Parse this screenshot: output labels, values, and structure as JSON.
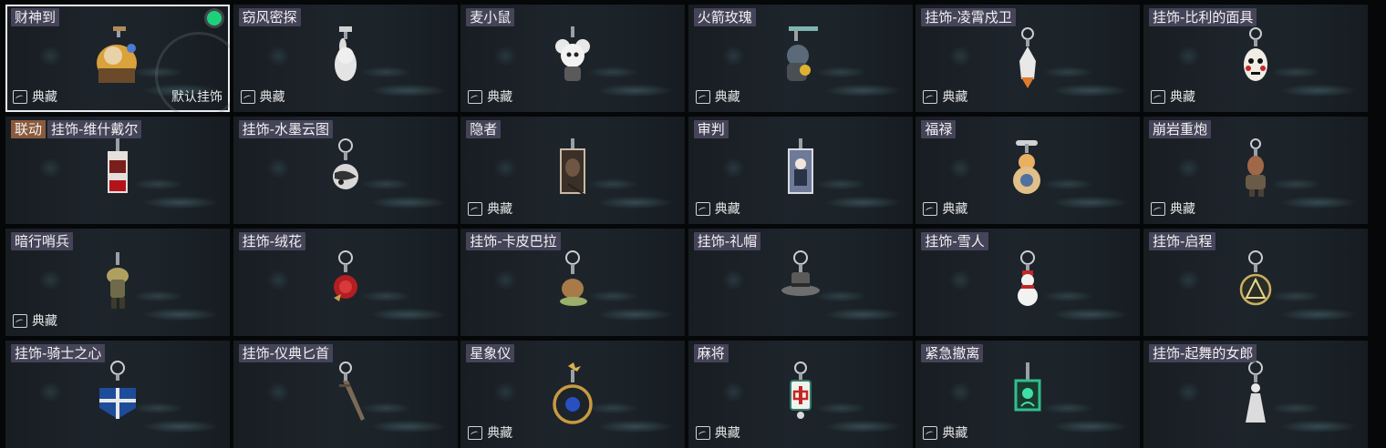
{
  "collect_label": "典藏",
  "default_label": "默认挂饰",
  "colors": {
    "selected_dot": "#1ed07c",
    "name_bg": "#4e4a62",
    "collab_tag_bg": "#8a5a3c"
  },
  "items": [
    {
      "name": "财神到",
      "collect": true,
      "selected": true,
      "icon": "god-of-wealth-charm-icon"
    },
    {
      "name": "窃风密探",
      "collect": true,
      "icon": "rabbit-spy-charm-icon"
    },
    {
      "name": "麦小鼠",
      "collect": true,
      "icon": "mouse-charm-icon"
    },
    {
      "name": "火箭玫瑰",
      "collect": true,
      "icon": "rocket-rose-charm-icon"
    },
    {
      "name": "挂饰-凌霄戍卫",
      "collect": true,
      "icon": "rocket-charm-icon"
    },
    {
      "name": "挂饰-比利的面具",
      "collect": true,
      "icon": "billy-mask-charm-icon"
    },
    {
      "name": "挂饰-维什戴尔",
      "tag": "联动",
      "collect": false,
      "icon": "card-charm-icon"
    },
    {
      "name": "挂饰-水墨云图",
      "collect": false,
      "icon": "ink-ball-charm-icon"
    },
    {
      "name": "隐者",
      "collect": true,
      "icon": "hermit-card-charm-icon"
    },
    {
      "name": "审判",
      "collect": true,
      "icon": "judgement-card-charm-icon"
    },
    {
      "name": "福禄",
      "collect": true,
      "icon": "gourd-charm-icon"
    },
    {
      "name": "崩岩重炮",
      "collect": true,
      "icon": "cannon-figure-charm-icon"
    },
    {
      "name": "暗行哨兵",
      "collect": true,
      "icon": "sentinel-charm-icon"
    },
    {
      "name": "挂饰-绒花",
      "collect": false,
      "icon": "rose-charm-icon"
    },
    {
      "name": "挂饰-卡皮巴拉",
      "collect": false,
      "icon": "capybara-charm-icon"
    },
    {
      "name": "挂饰-礼帽",
      "collect": false,
      "icon": "top-hat-charm-icon"
    },
    {
      "name": "挂饰-雪人",
      "collect": false,
      "icon": "snowman-charm-icon"
    },
    {
      "name": "挂饰-启程",
      "collect": false,
      "icon": "triangle-medal-charm-icon"
    },
    {
      "name": "挂饰-骑士之心",
      "collect": false,
      "icon": "knight-shield-charm-icon"
    },
    {
      "name": "挂饰-仪典匕首",
      "collect": false,
      "icon": "dagger-charm-icon"
    },
    {
      "name": "星象仪",
      "collect": true,
      "icon": "astrolabe-charm-icon"
    },
    {
      "name": "麻将",
      "collect": true,
      "icon": "mahjong-tile-charm-icon"
    },
    {
      "name": "紧急撤离",
      "collect": true,
      "icon": "green-frame-charm-icon"
    },
    {
      "name": "挂饰-起舞的女郎",
      "collect": false,
      "icon": "dancer-charm-icon"
    }
  ]
}
